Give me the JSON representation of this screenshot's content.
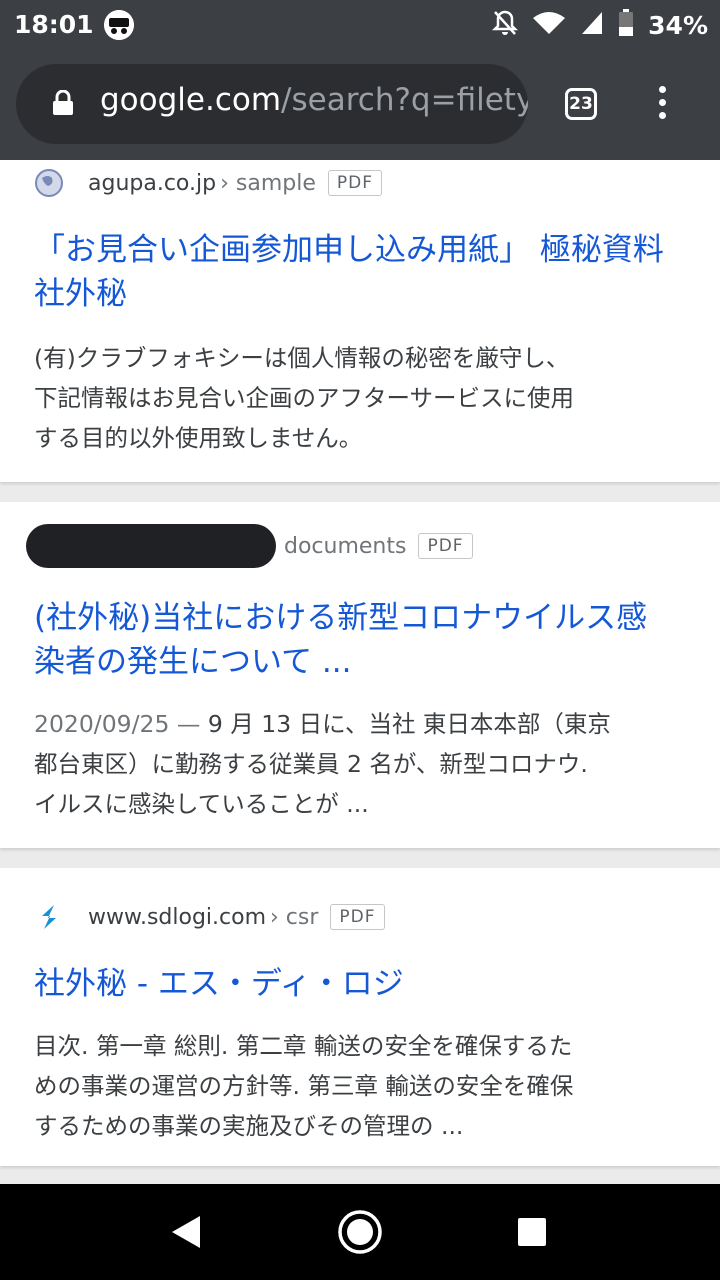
{
  "status_bar": {
    "time": "18:01",
    "battery": "34%",
    "icons": [
      "notifications-off-icon",
      "wifi-icon",
      "signal-icon",
      "battery-icon"
    ]
  },
  "browser": {
    "url_host": "google.com",
    "url_rest": "/search?q=filetyp",
    "tab_count": "23"
  },
  "results": [
    {
      "domain": "agupa.co.jp",
      "path": "› sample",
      "badge": "PDF",
      "title": "「お見合い企画参加申し込み用紙」 極秘資料 社外秘",
      "snippet_lines": [
        "(有)クラブフォキシーは個人情報の秘密を厳守し、",
        "下記情報はお見合い企画のアフターサービスに使用",
        "する目的以外使用致しません。"
      ]
    },
    {
      "domain": "",
      "path": "documents",
      "badge": "PDF",
      "title": "(社外秘)当社における新型コロナウイルス感染者の発生について ...",
      "date": "2020/09/25 —",
      "snippet_lines": [
        " 9 月 13 日に、当社 東日本本部（東京",
        "都台東区）に勤務する従業員 2 名が、新型コロナウ.",
        "イルスに感染していることが ..."
      ]
    },
    {
      "domain": "www.sdlogi.com",
      "path": "› csr",
      "badge": "PDF",
      "title": "社外秘 - エス・ディ・ロジ",
      "snippet_lines": [
        "目次. 第一章 総則. 第二章 輸送の安全を確保するた",
        "めの事業の運営の方針等. 第三章 輸送の安全を確保",
        "するための事業の実施及びその管理の ..."
      ]
    }
  ],
  "colors": {
    "link": "#1558d6",
    "chrome": "#3c3f43"
  }
}
